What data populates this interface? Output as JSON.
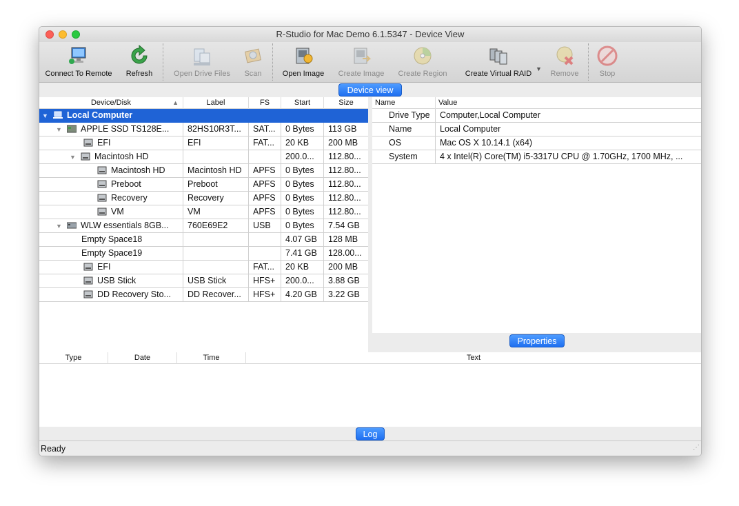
{
  "window": {
    "title": "R-Studio for Mac Demo 6.1.5347 - Device View"
  },
  "toolbar": {
    "connect": "Connect To Remote",
    "refresh": "Refresh",
    "open_drive_files": "Open Drive Files",
    "scan": "Scan",
    "open_image": "Open Image",
    "create_image": "Create Image",
    "create_region": "Create Region",
    "create_virtual_raid": "Create Virtual RAID",
    "remove": "Remove",
    "stop": "Stop"
  },
  "panels": {
    "device_view": "Device view",
    "properties": "Properties",
    "log": "Log"
  },
  "device_table": {
    "headers": [
      "Device/Disk",
      "Label",
      "FS",
      "Start",
      "Size"
    ],
    "rows": [
      {
        "name": "Local Computer",
        "label": "",
        "fs": "",
        "start": "",
        "size": ""
      },
      {
        "name": "APPLE SSD TS128E...",
        "label": "82HS10R3T...",
        "fs": "SAT...",
        "start": "0 Bytes",
        "size": "113 GB"
      },
      {
        "name": "EFI",
        "label": "EFI",
        "fs": "FAT...",
        "start": "20 KB",
        "size": "200 MB"
      },
      {
        "name": "Macintosh HD",
        "label": "",
        "fs": "",
        "start": "200.0...",
        "size": "112.80..."
      },
      {
        "name": "Macintosh HD",
        "label": "Macintosh HD",
        "fs": "APFS",
        "start": "0 Bytes",
        "size": "112.80..."
      },
      {
        "name": "Preboot",
        "label": "Preboot",
        "fs": "APFS",
        "start": "0 Bytes",
        "size": "112.80..."
      },
      {
        "name": "Recovery",
        "label": "Recovery",
        "fs": "APFS",
        "start": "0 Bytes",
        "size": "112.80..."
      },
      {
        "name": "VM",
        "label": "VM",
        "fs": "APFS",
        "start": "0 Bytes",
        "size": "112.80..."
      },
      {
        "name": "WLW essentials 8GB...",
        "label": "760E69E2",
        "fs": "USB",
        "start": "0 Bytes",
        "size": "7.54 GB"
      },
      {
        "name": "Empty Space18",
        "label": "",
        "fs": "",
        "start": "4.07 GB",
        "size": "128 MB"
      },
      {
        "name": "Empty Space19",
        "label": "",
        "fs": "",
        "start": "7.41 GB",
        "size": "128.00..."
      },
      {
        "name": "EFI",
        "label": "",
        "fs": "FAT...",
        "start": "20 KB",
        "size": "200 MB"
      },
      {
        "name": "USB Stick",
        "label": "USB Stick",
        "fs": "HFS+",
        "start": "200.0...",
        "size": "3.88 GB"
      },
      {
        "name": "DD Recovery Sto...",
        "label": "DD Recover...",
        "fs": "HFS+",
        "start": "4.20 GB",
        "size": "3.22 GB"
      }
    ]
  },
  "properties": {
    "headers": [
      "Name",
      "Value"
    ],
    "rows": [
      {
        "name": "Drive Type",
        "value": "Computer,Local Computer"
      },
      {
        "name": "Name",
        "value": "Local Computer"
      },
      {
        "name": "OS",
        "value": "Mac OS X 10.14.1 (x64)"
      },
      {
        "name": "System",
        "value": "4 x Intel(R) Core(TM) i5-3317U CPU @ 1.70GHz, 1700 MHz, ..."
      }
    ]
  },
  "log": {
    "headers": [
      "Type",
      "Date",
      "Time",
      "Text"
    ]
  },
  "status": {
    "text": "Ready"
  },
  "colors": {
    "selection": "#1f63d6",
    "pill": "#2f7ff5"
  }
}
